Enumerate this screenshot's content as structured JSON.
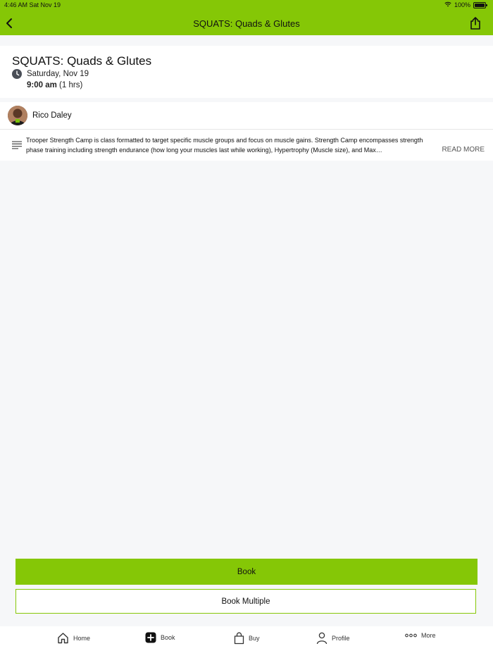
{
  "status_bar": {
    "time": "4:46 AM  Sat Nov 19",
    "battery": "100%"
  },
  "nav": {
    "title": "SQUATS: Quads & Glutes"
  },
  "class": {
    "title": "SQUATS: Quads & Glutes",
    "date": "Saturday, Nov 19",
    "time": "9:00 am",
    "duration": "(1 hrs)"
  },
  "instructor": {
    "name": "Rico Daley"
  },
  "description": {
    "text": "Trooper Strength Camp is class formatted to target specific muscle groups and focus on muscle gains. Strength Camp encompasses strength phase training including strength endurance (how long your muscles last while working), Hypertrophy (Muscle size), and Max…",
    "read_more": "READ MORE"
  },
  "actions": {
    "book": "Book",
    "book_multiple": "Book Multiple"
  },
  "tabbar": [
    {
      "label": "Home",
      "icon": "home-icon"
    },
    {
      "label": "Book",
      "icon": "plus-square-icon"
    },
    {
      "label": "Buy",
      "icon": "shopping-bag-icon"
    },
    {
      "label": "Profile",
      "icon": "user-icon"
    },
    {
      "label": "More",
      "icon": "more-dots-icon"
    }
  ],
  "colors": {
    "accent": "#85c706",
    "background": "#f6f7f9"
  }
}
